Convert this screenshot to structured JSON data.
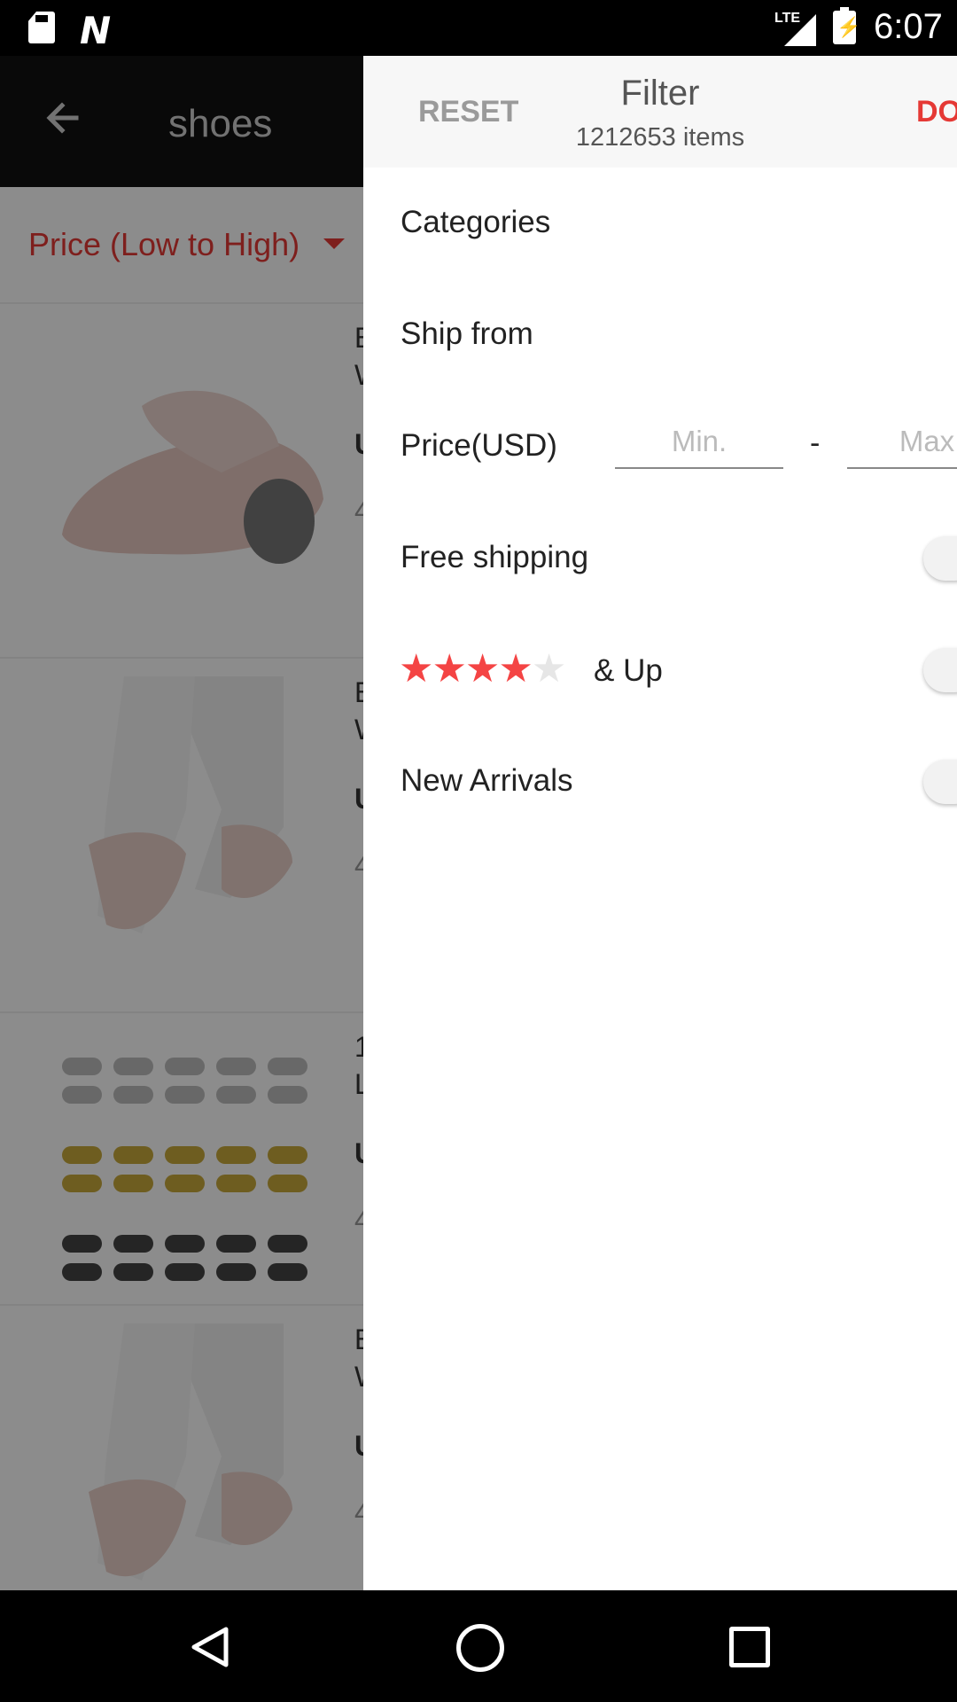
{
  "status_bar": {
    "time": "6:07",
    "network": "LTE",
    "icons": [
      "sd-card-icon",
      "n-logo-icon",
      "signal-icon",
      "battery-charging-icon"
    ]
  },
  "app_bar": {
    "title": "shoes",
    "back_icon": "arrow-left-icon"
  },
  "sort": {
    "label": "Price (Low to High)",
    "icon": "caret-down-icon"
  },
  "products_partial": [
    {
      "line1": "B",
      "line2": "W",
      "price_fragment": "U",
      "rating_fragment": "4"
    },
    {
      "line1": "B",
      "line2": "W",
      "price_fragment": "U",
      "rating_fragment": "4"
    },
    {
      "line1": "1",
      "line2": "L",
      "price_fragment": "U",
      "rating_fragment": "4"
    },
    {
      "line1": "B",
      "line2": "W",
      "price_fragment": "U",
      "rating_fragment": "4"
    }
  ],
  "drawer": {
    "reset_label": "RESET",
    "title": "Filter",
    "count": "1212653 items",
    "done_label": "DO",
    "categories_label": "Categories",
    "ship_from_label": "Ship from",
    "price": {
      "label": "Price(USD)",
      "min_placeholder": "Min.",
      "dash": "-",
      "max_placeholder": "Max"
    },
    "free_shipping_label": "Free shipping",
    "rating": {
      "stars": 4,
      "max_stars": 5,
      "suffix": "& Up"
    },
    "new_arrivals_label": "New Arrivals"
  },
  "colors": {
    "accent": "#e53935",
    "star": "#f44444"
  },
  "nav_bar": {
    "icons": [
      "back-triangle-icon",
      "home-circle-icon",
      "recents-square-icon"
    ]
  }
}
